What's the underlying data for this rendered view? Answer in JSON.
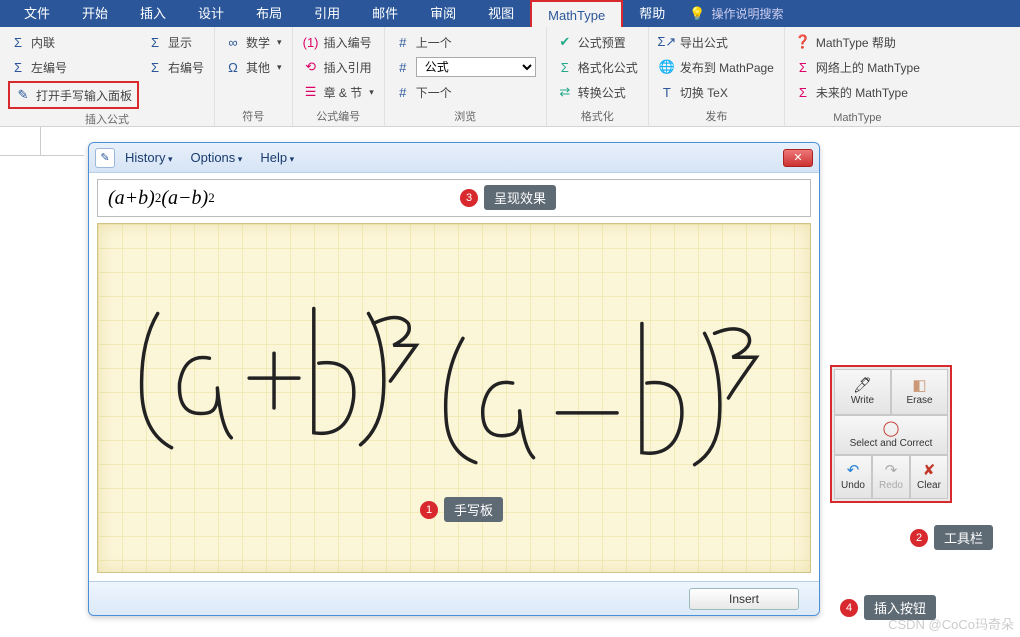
{
  "menu": {
    "tabs": [
      "文件",
      "开始",
      "插入",
      "设计",
      "布局",
      "引用",
      "邮件",
      "审阅",
      "视图",
      "MathType",
      "帮助"
    ],
    "active_index": 9,
    "search": "操作说明搜索"
  },
  "ribbon": {
    "groups": [
      {
        "label": "插入公式",
        "items": [
          [
            "内联",
            "左编号",
            "打开手写输入面板"
          ],
          [
            "显示",
            "右编号"
          ]
        ]
      },
      {
        "label": "符号",
        "items": [
          [
            "数学"
          ],
          [
            "其他"
          ]
        ]
      },
      {
        "label": "公式编号",
        "items": [
          [
            "插入编号",
            "插入引用",
            "章 & 节"
          ]
        ]
      },
      {
        "label": "浏览",
        "items": [
          [
            "上一个",
            "公式",
            "下一个"
          ]
        ]
      },
      {
        "label": "格式化",
        "items": [
          [
            "公式预置",
            "格式化公式",
            "转换公式"
          ]
        ]
      },
      {
        "label": "发布",
        "items": [
          [
            "导出公式",
            "发布到 MathPage",
            "切换 TeX"
          ]
        ]
      },
      {
        "label": "MathType",
        "items": [
          [
            "MathType 帮助",
            "网络上的 MathType",
            "未来的 MathType"
          ]
        ]
      }
    ],
    "formula_select": "公式"
  },
  "hw": {
    "menus": [
      "History",
      "Options",
      "Help"
    ],
    "result": "(a + b)²(a − b)²",
    "insert": "Insert"
  },
  "tools": {
    "write": "Write",
    "erase": "Erase",
    "select": "Select and Correct",
    "undo": "Undo",
    "redo": "Redo",
    "clear": "Clear"
  },
  "callouts": {
    "c1": "手写板",
    "c2": "工具栏",
    "c3": "呈现效果",
    "c4": "插入按钮"
  },
  "watermark": "CSDN @CoCo玛奇朵"
}
